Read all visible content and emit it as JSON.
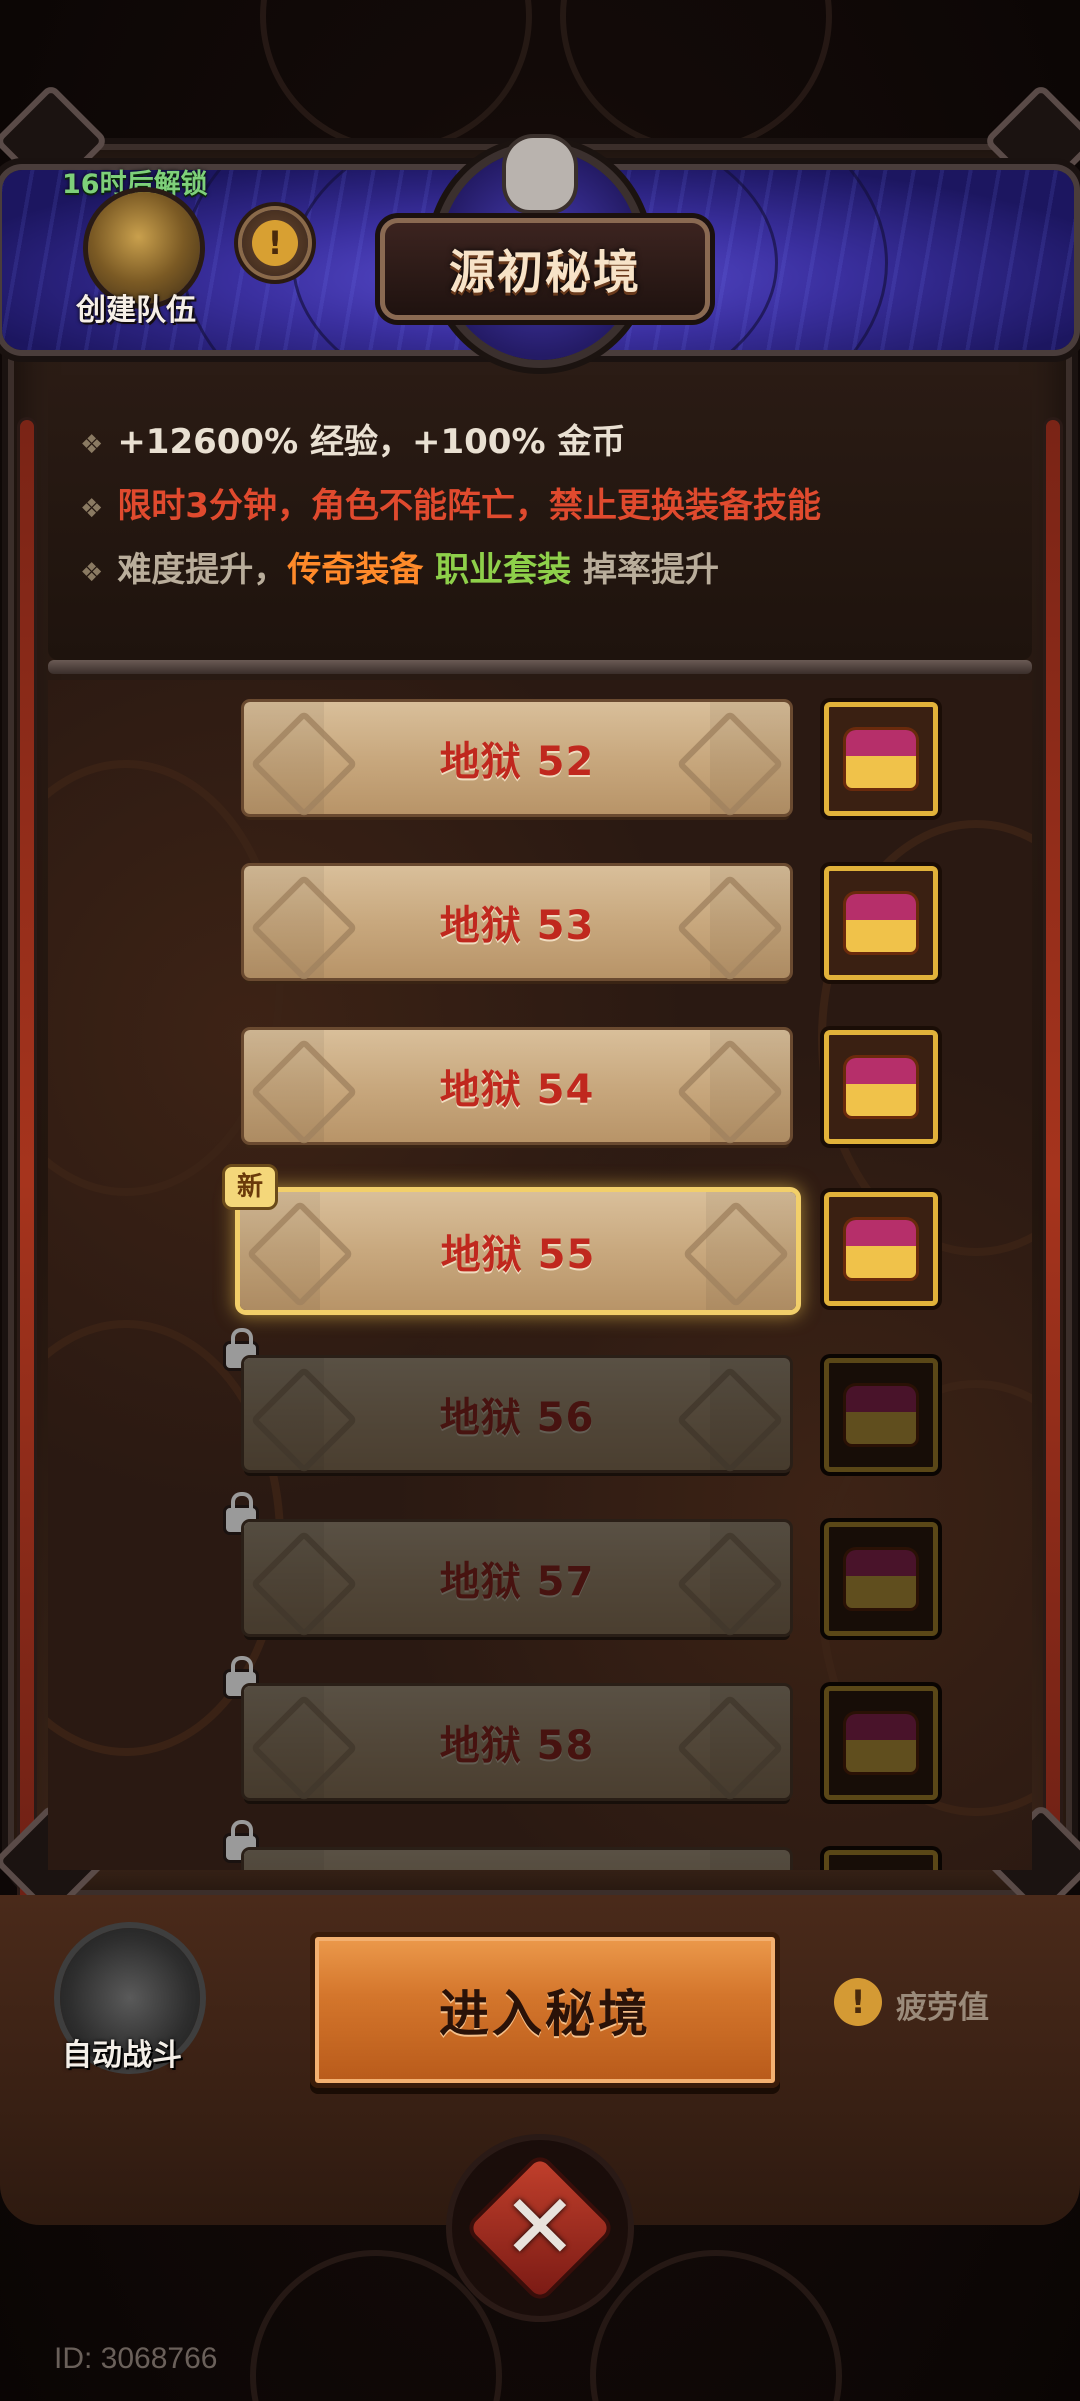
{
  "header": {
    "title": "源初秘境",
    "unlock_timer": "16时后解锁",
    "team_label": "创建队伍",
    "info_glyph": "!"
  },
  "info": {
    "line1": "+12600% 经验，+100% 金币",
    "line2": "限时3分钟，角色不能阵亡，禁止更换装备技能",
    "line3_prefix": "难度提升，",
    "line3_legendary": "传奇装备",
    "line3_set": "职业套装",
    "line3_suffix": "掉率提升",
    "bullet": "❖"
  },
  "levels": [
    {
      "label": "地狱 52",
      "state": "unlocked"
    },
    {
      "label": "地狱 53",
      "state": "unlocked"
    },
    {
      "label": "地狱 54",
      "state": "unlocked"
    },
    {
      "label": "地狱 55",
      "state": "selected",
      "badge": "新"
    },
    {
      "label": "地狱 56",
      "state": "locked"
    },
    {
      "label": "地狱 57",
      "state": "locked"
    },
    {
      "label": "地狱 58",
      "state": "locked"
    }
  ],
  "footer": {
    "auto_battle_label": "自动战斗",
    "enter_label": "进入秘境",
    "fatigue_label": "疲劳值",
    "fatigue_glyph": "!",
    "close_glyph": "✕"
  },
  "player_id": "ID: 3068766",
  "colors": {
    "accent_orange": "#ff8a2a",
    "accent_green": "#8ed04a",
    "warning_red": "#e04a2e",
    "level_text": "#c0281e",
    "selected_glow": "#f2cf6a"
  }
}
